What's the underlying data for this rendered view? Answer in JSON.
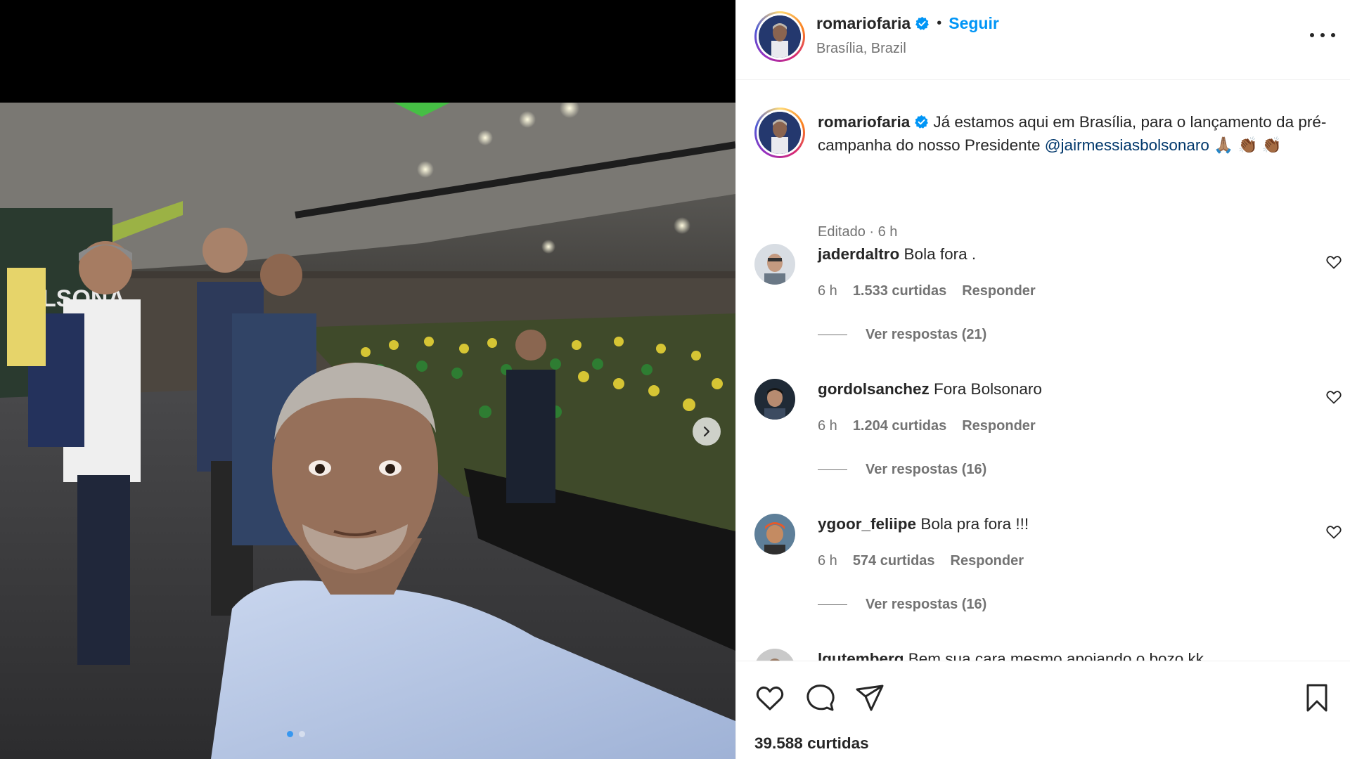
{
  "post": {
    "author": "romariofaria",
    "follow_label": "Seguir",
    "separator": "•",
    "location": "Brasília, Brazil",
    "caption_prefix": "Já estamos aqui em Brasília, para o lançamento da pré-campanha do nosso Presidente ",
    "caption_mention": "@jairmessiasbolsonaro",
    "caption_emojis": "🙏🏽 👏🏾 👏🏾",
    "caption_meta": "Editado · 6 h",
    "likes_label": "39.588 curtidas"
  },
  "comments": [
    {
      "user": "jaderdaltro",
      "text": "Bola fora .",
      "time": "6 h",
      "likes": "1.533 curtidas",
      "reply_label": "Responder",
      "view_replies": "Ver respostas (21)"
    },
    {
      "user": "gordolsanchez",
      "text": "Fora Bolsonaro",
      "time": "6 h",
      "likes": "1.204 curtidas",
      "reply_label": "Responder",
      "view_replies": "Ver respostas (16)"
    },
    {
      "user": "ygoor_feliipe",
      "text": "Bola pra fora !!!",
      "time": "6 h",
      "likes": "574 curtidas",
      "reply_label": "Responder",
      "view_replies": "Ver respostas (16)"
    },
    {
      "user": "lgutemberg",
      "text": "Bem sua cara mesmo apoiando o bozo kk"
    }
  ],
  "carousel": {
    "current": 1,
    "total": 2
  },
  "icons": {
    "verified": "verified-badge-icon",
    "more": "more-options-icon",
    "like": "heart-icon",
    "comment": "comment-icon",
    "share": "share-icon",
    "save": "bookmark-icon",
    "next": "chevron-right-icon"
  },
  "colors": {
    "accent": "#0095f6",
    "verified": "#0095f6",
    "muted": "#737373",
    "mention": "#00376b"
  }
}
